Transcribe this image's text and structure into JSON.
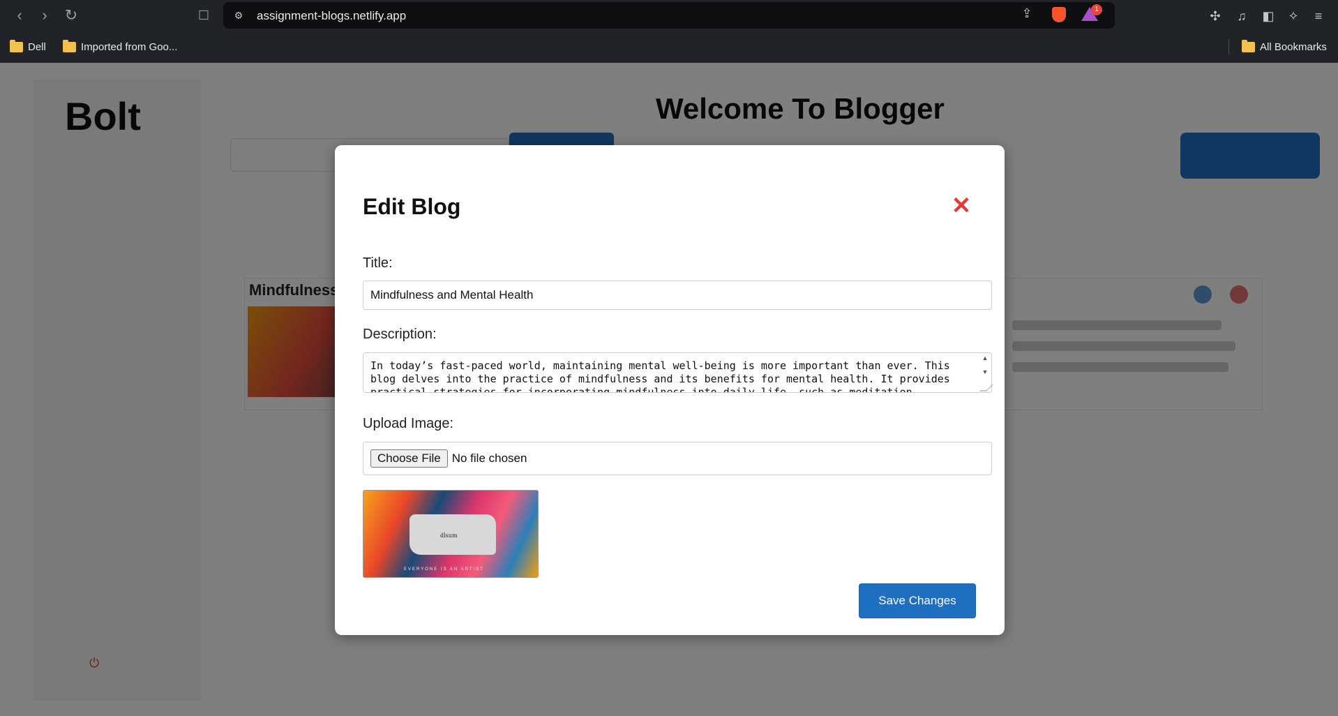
{
  "browser": {
    "url": "assignment-blogs.netlify.app",
    "notification_count": "1",
    "bookmarks": [
      {
        "label": "Dell"
      },
      {
        "label": "Imported from Goo..."
      }
    ],
    "all_bookmarks_label": "All Bookmarks",
    "icons": [
      "back-icon",
      "forward-icon",
      "reload-icon",
      "bookmark-icon",
      "site-info-icon",
      "share-icon",
      "brave-shields-icon",
      "brave-rewards-icon",
      "extensions-icon",
      "media-icon",
      "sidebar-icon",
      "leo-ai-icon",
      "menu-icon"
    ]
  },
  "background": {
    "logo": "Bolt",
    "welcome_title": "Welcome To Blogger",
    "card_title": "Mindfulness and Mental Health"
  },
  "modal": {
    "title": "Edit Blog",
    "close_glyph": "✕",
    "title_label": "Title:",
    "title_value": "Mindfulness and Mental Health",
    "description_label": "Description:",
    "description_value": "In today’s fast-paced world, maintaining mental well-being is more important than ever. This blog delves into the practice of mindfulness and its benefits for mental health. It provides practical strategies for incorporating mindfulness into daily life, such as meditation,",
    "upload_label": "Upload Image:",
    "choose_file_label": "Choose File",
    "no_file_label": "No file chosen",
    "preview_image": {
      "center_text": "dlsum",
      "caption": "EVERYONE IS AN ARTIST"
    },
    "save_label": "Save Changes"
  },
  "colors": {
    "accent": "#1e6fc0",
    "close": "#e53935"
  }
}
